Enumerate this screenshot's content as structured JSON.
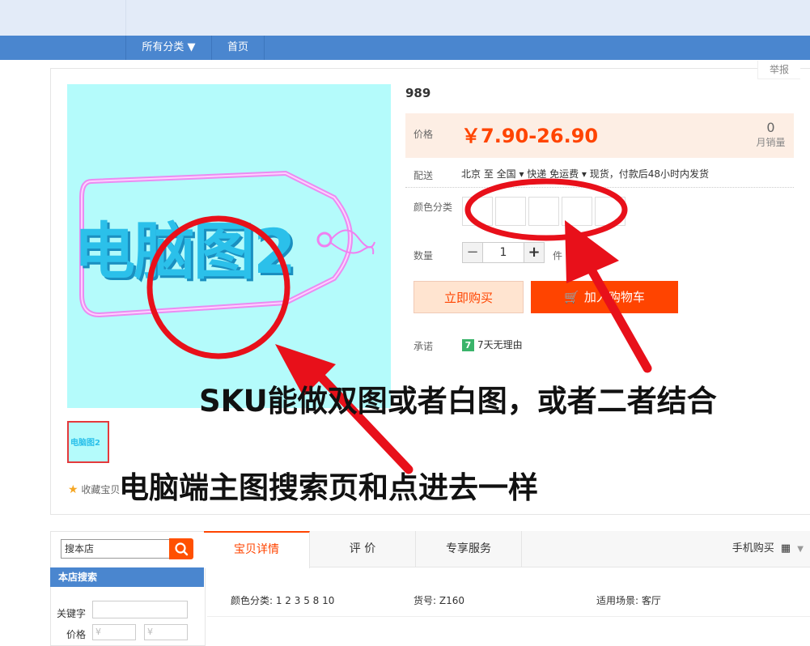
{
  "nav": {
    "all_categories": "所有分类 ▼",
    "home": "首页"
  },
  "report": "举报",
  "product": {
    "title": "989",
    "price_label": "价格",
    "price": "￥7.90-26.90",
    "monthly_sales_count": "0",
    "monthly_sales_label": "月销量",
    "delivery_label": "配送",
    "delivery_route": "北京 至  全国 ▾   快递 免运费 ▾   现货，付款后48小时内发货",
    "color_label": "颜色分类",
    "qty_label": "数量",
    "qty_value": "1",
    "qty_unit": "件",
    "buy_now": "立即购买",
    "add_to_cart": "加入购物车",
    "promise_label": "承诺",
    "promise_badge": "7",
    "promise_text": "7天无理由",
    "image_text": "电脑图2",
    "thumb_text": "电脑图2",
    "favorite": "收藏宝贝"
  },
  "annotations": {
    "sku_note": "SKU能做双图或者白图，或者二者结合",
    "main_note": "电脑端主图搜索页和点进去一样"
  },
  "sidebar": {
    "search_placeholder": "搜本店",
    "store_search_title": "本店搜索",
    "keyword_label": "关键字",
    "price_label": "价格",
    "price_min_placeholder": "¥",
    "price_max_placeholder": "¥"
  },
  "tabs": [
    {
      "label": "宝贝详情"
    },
    {
      "label": "评  价"
    },
    {
      "label": "专享服务"
    }
  ],
  "mobile_buy": "手机购买",
  "attributes": {
    "color": "颜色分类: 1 2 3 5 8 10",
    "sku_no": "货号: Z160",
    "scene": "适用场景: 客厅"
  },
  "colors": {
    "accent": "#ff4400",
    "nav_blue": "#4a86cf",
    "annotation_red": "#e8101a"
  }
}
